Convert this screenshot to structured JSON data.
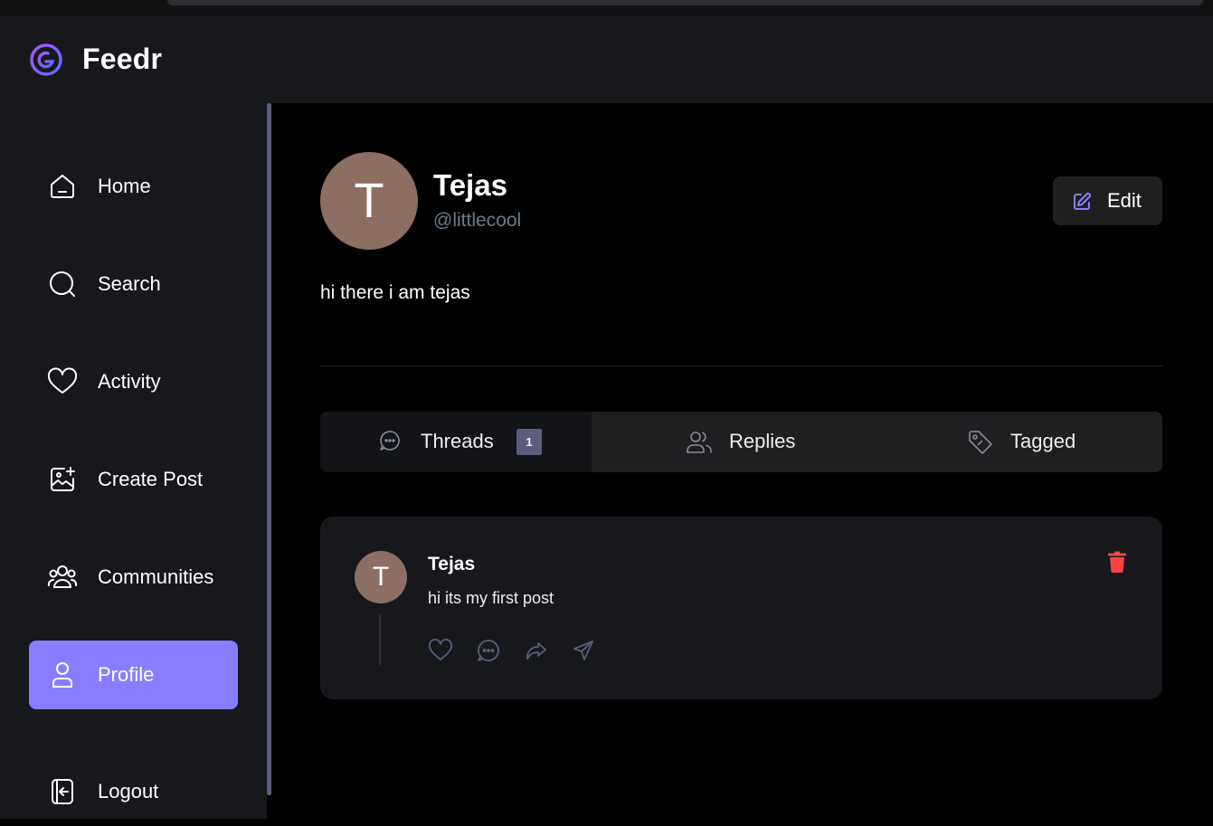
{
  "app": {
    "name": "Feedr",
    "brand_color": "#877eff"
  },
  "sidebar": {
    "items": [
      {
        "label": "Home",
        "icon": "home-icon",
        "active": false
      },
      {
        "label": "Search",
        "icon": "search-icon",
        "active": false
      },
      {
        "label": "Activity",
        "icon": "heart-icon",
        "active": false
      },
      {
        "label": "Create Post",
        "icon": "image-plus-icon",
        "active": false
      },
      {
        "label": "Communities",
        "icon": "users-icon",
        "active": false
      },
      {
        "label": "Profile",
        "icon": "user-icon",
        "active": true
      },
      {
        "label": "Logout",
        "icon": "logout-icon",
        "active": false
      }
    ]
  },
  "profile": {
    "avatar_initial": "T",
    "name": "Tejas",
    "handle": "@littlecool",
    "bio": "hi there i am tejas",
    "edit_label": "Edit"
  },
  "tabs": [
    {
      "label": "Threads",
      "icon": "chat-bubble-icon",
      "count": "1",
      "active": true
    },
    {
      "label": "Replies",
      "icon": "users-icon",
      "active": false
    },
    {
      "label": "Tagged",
      "icon": "tag-icon",
      "active": false
    }
  ],
  "posts": [
    {
      "avatar_initial": "T",
      "author": "Tejas",
      "text": "hi its my first post",
      "actions": [
        "heart-icon",
        "reply-icon",
        "repost-icon",
        "share-icon"
      ],
      "delete_icon": "trash-icon",
      "delete_color": "#ff4444"
    }
  ]
}
